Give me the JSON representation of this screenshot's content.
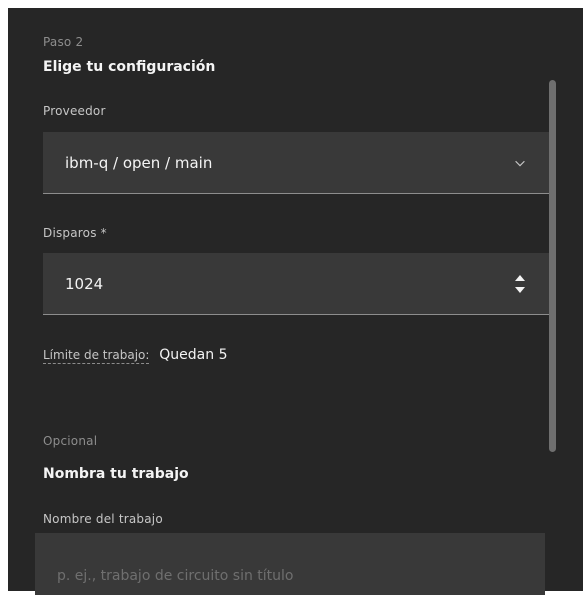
{
  "step": {
    "label": "Paso 2",
    "title": "Elige tu configuración"
  },
  "provider": {
    "label": "Proveedor",
    "value": "ibm-q / open / main"
  },
  "shots": {
    "label": "Disparos *",
    "value": "1024"
  },
  "job_limit": {
    "label": "Límite de trabajo:",
    "value": "Quedan 5"
  },
  "optional": {
    "label": "Opcional",
    "title": "Nombra tu trabajo"
  },
  "job_name": {
    "label": "Nombre del trabajo",
    "placeholder": "p. ej., trabajo de circuito sin título",
    "value": ""
  },
  "icons": {
    "provider_dropdown": "chevron-down-icon",
    "shots_stepper": "caret-up-down-icon"
  },
  "colors": {
    "panel_bg": "#262626",
    "field_bg": "#393939",
    "text_primary": "#f4f4f4",
    "text_secondary": "#c6c6c6",
    "text_muted": "#8d8d8d"
  }
}
